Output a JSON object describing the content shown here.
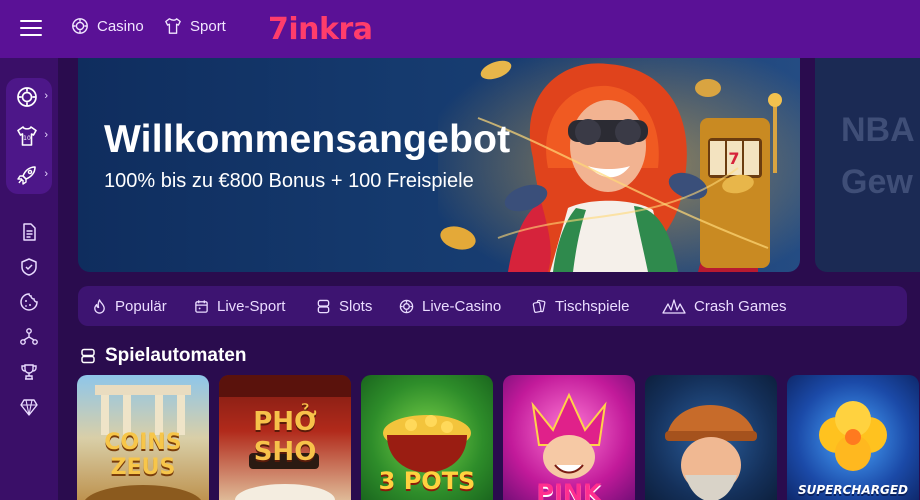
{
  "header": {
    "nav": [
      {
        "label": "Casino",
        "icon": "casino-chip-icon"
      },
      {
        "label": "Sport",
        "icon": "jersey-icon"
      }
    ],
    "logo_text": "7inkra",
    "brand_color": "#ff3d6b"
  },
  "sidebar": {
    "group": [
      {
        "icon": "casino-chip-icon"
      },
      {
        "icon": "jersey-icon"
      },
      {
        "icon": "rocket-icon"
      }
    ],
    "icons": [
      "document-icon",
      "shield-check-icon",
      "cookie-icon",
      "network-icon",
      "trophy-icon",
      "diamond-icon"
    ]
  },
  "banner": {
    "title": "Willkommensangebot",
    "subtitle": "100% bis zu €800 Bonus + 100 Freispiele"
  },
  "banner2": {
    "line1": "NBA",
    "line2": "Gew"
  },
  "categories": [
    {
      "label": "Populär",
      "icon": "flame-icon"
    },
    {
      "label": "Live-Sport",
      "icon": "calendar-icon"
    },
    {
      "label": "Slots",
      "icon": "slot-icon"
    },
    {
      "label": "Live-Casino",
      "icon": "casino-chip-icon"
    },
    {
      "label": "Tischspiele",
      "icon": "cards-icon"
    },
    {
      "label": "Crash Games",
      "icon": "crash-icon"
    }
  ],
  "section": {
    "title": "Spielautomaten"
  },
  "games": [
    {
      "name": "COINS ZEUS"
    },
    {
      "name": "PHỞ SHO"
    },
    {
      "name": "3 POTS"
    },
    {
      "name": "PINK"
    },
    {
      "name": ""
    },
    {
      "name": "SUPERCHARGED"
    }
  ]
}
